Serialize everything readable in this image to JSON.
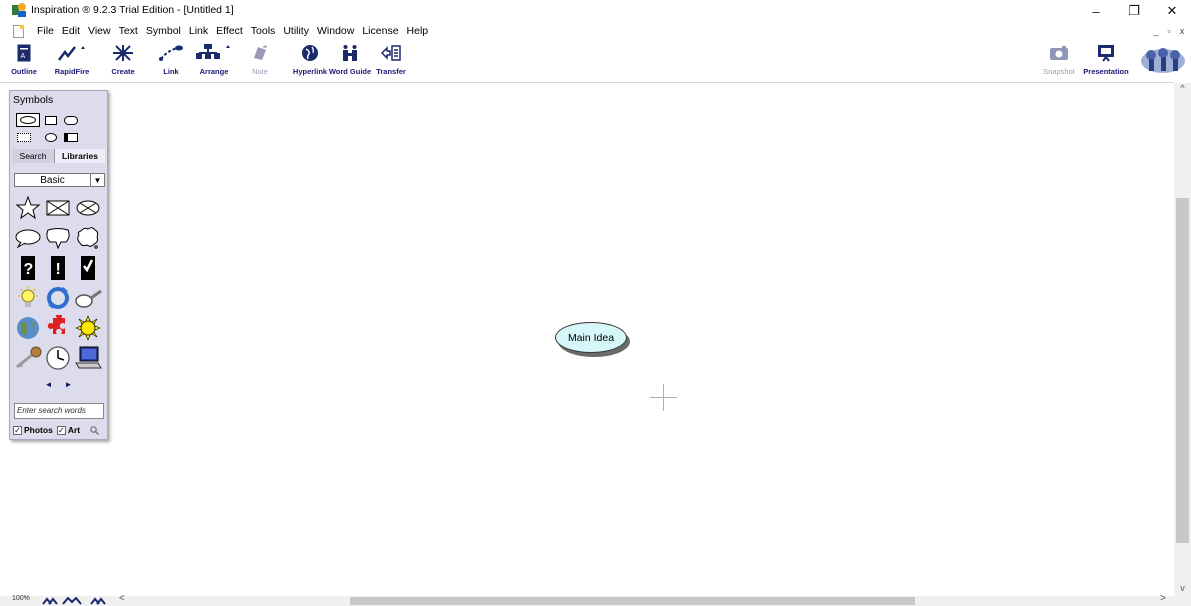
{
  "window": {
    "title": "Inspiration ® 9.2.3 Trial Edition - [Untitled 1]",
    "controls": {
      "minimize": "–",
      "restore": "❐",
      "close": "✕"
    }
  },
  "menu": [
    "File",
    "Edit",
    "View",
    "Text",
    "Symbol",
    "Link",
    "Effect",
    "Tools",
    "Utility",
    "Window",
    "License",
    "Help"
  ],
  "mdi_controls": {
    "minimize": "_",
    "restore": "▫",
    "close": "x"
  },
  "toolbar": {
    "outline": "Outline",
    "rapidfire": "RapidFire",
    "create": "Create",
    "link": "Link",
    "arrange": "Arrange",
    "note": "Note",
    "hyperlink": "Hyperlink",
    "word_guide": "Word Guide",
    "transfer": "Transfer",
    "snapshot": "Snapshot",
    "presentation": "Presentation"
  },
  "symbols_palette": {
    "title": "Symbols",
    "tabs": {
      "search": "Search",
      "libraries": "Libraries"
    },
    "library": "Basic",
    "nav_prev": "◄",
    "nav_next": "►",
    "search_placeholder": "Enter search words",
    "photos_label": "Photos",
    "art_label": "Art",
    "check": "✓"
  },
  "canvas": {
    "main_idea": "Main Idea"
  },
  "status": {
    "zoom": "100%"
  },
  "scroll": {
    "up": "^",
    "down": "v",
    "left": "<",
    "right": ">"
  },
  "colors": {
    "node_fill": "#d6f6fa",
    "palette_bg": "#dcdcec",
    "toolbar_label": "#1a1a7a"
  }
}
